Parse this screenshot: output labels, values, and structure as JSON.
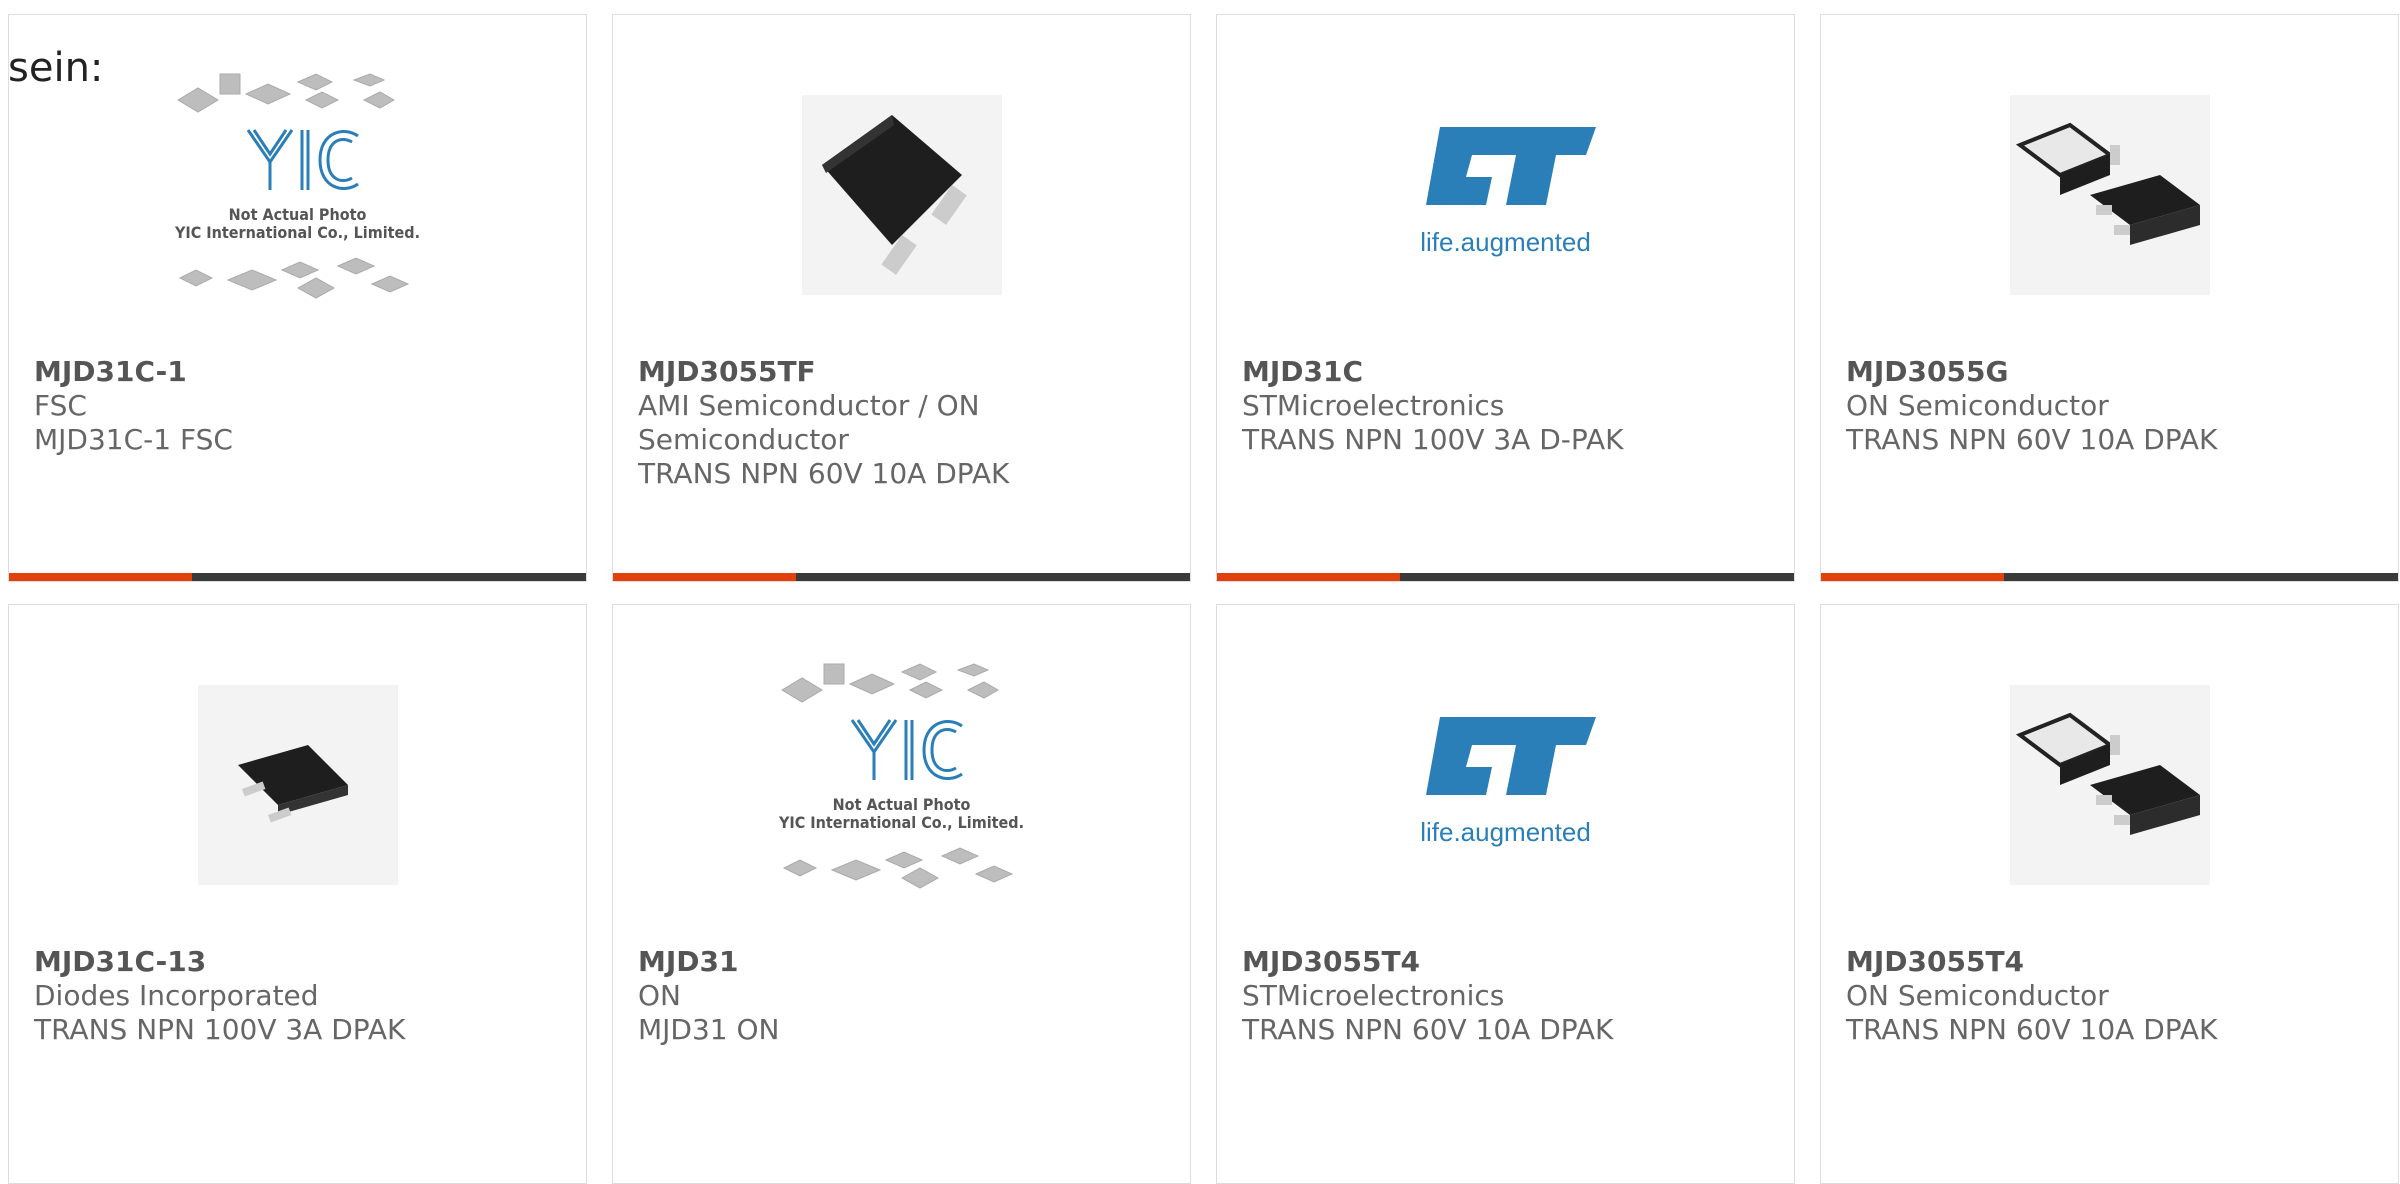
{
  "intro": "sein:",
  "cards": [
    {
      "part": "MJD31C-1",
      "maker": "FSC",
      "desc": "MJD31C-1 FSC",
      "image": "yic-placeholder-photo",
      "yic_caption_1": "Not Actual Photo",
      "yic_caption_2": "YIC International Co., Limited."
    },
    {
      "part": "MJD3055TF",
      "maker": "AMI Semiconductor / ON Semiconductor",
      "desc": "TRANS NPN 60V 10A DPAK",
      "image": "dpak-transistor-photo"
    },
    {
      "part": "MJD31C",
      "maker": "STMicroelectronics",
      "desc": "TRANS NPN 100V 3A D-PAK",
      "image": "st-logo",
      "logo_tagline": "life.augmented"
    },
    {
      "part": "MJD3055G",
      "maker": "ON Semiconductor",
      "desc": "TRANS NPN 60V 10A DPAK",
      "image": "dpak-pair-photo"
    },
    {
      "part": "MJD31C-13",
      "maker": "Diodes Incorporated",
      "desc": "TRANS NPN 100V 3A DPAK",
      "image": "dpak-transistor-photo"
    },
    {
      "part": "MJD31",
      "maker": "ON",
      "desc": "MJD31 ON",
      "image": "yic-placeholder-photo",
      "yic_caption_1": "Not Actual Photo",
      "yic_caption_2": "YIC International Co., Limited."
    },
    {
      "part": "MJD3055T4",
      "maker": "STMicroelectronics",
      "desc": "TRANS NPN 60V 10A DPAK",
      "image": "st-logo",
      "logo_tagline": "life.augmented"
    },
    {
      "part": "MJD3055T4",
      "maker": "ON Semiconductor",
      "desc": "TRANS NPN 60V 10A DPAK",
      "image": "dpak-pair-photo"
    }
  ],
  "colors": {
    "accent": "#e2400d",
    "bar": "#3a3a3a",
    "st_blue": "#2a7fb8"
  }
}
